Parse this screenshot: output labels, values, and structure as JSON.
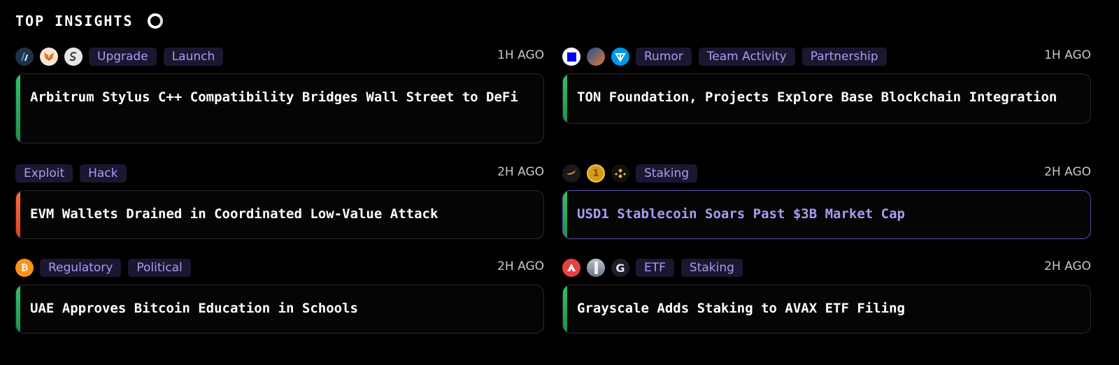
{
  "header": {
    "title": "TOP INSIGHTS"
  },
  "colors": {
    "green": "#2ec26a",
    "red": "#ff5a36",
    "tag_bg": "#1b1730",
    "tag_text": "#a99cf2"
  },
  "insights": [
    {
      "icons": [
        "arbitrum-icon",
        "metamask-icon",
        "sonic-icon"
      ],
      "tags": [
        "Upgrade",
        "Launch"
      ],
      "time": "1H AGO",
      "headline": "Arbitrum Stylus C++ Compatibility Bridges Wall Street to DeFi",
      "sentiment": "positive"
    },
    {
      "icons": [
        "blue-square-icon",
        "avatar-icon",
        "ton-icon"
      ],
      "tags": [
        "Rumor",
        "Team Activity",
        "Partnership"
      ],
      "time": "1H AGO",
      "headline": "TON Foundation, Projects Explore Base Blockchain Integration",
      "sentiment": "positive"
    },
    {
      "icons": [],
      "tags": [
        "Exploit",
        "Hack"
      ],
      "time": "2H AGO",
      "headline": "EVM Wallets Drained in Coordinated Low-Value Attack",
      "sentiment": "negative"
    },
    {
      "icons": [
        "bird-icon",
        "usd1-icon",
        "bnb-icon"
      ],
      "tags": [
        "Staking"
      ],
      "time": "2H AGO",
      "headline": "USD1 Stablecoin Soars Past $3B Market Cap",
      "sentiment": "positive",
      "highlighted": true
    },
    {
      "icons": [
        "bitcoin-icon"
      ],
      "tags": [
        "Regulatory",
        "Political"
      ],
      "time": "2H AGO",
      "headline": "UAE Approves Bitcoin Education in Schools",
      "sentiment": "positive"
    },
    {
      "icons": [
        "avalanche-icon",
        "tower-icon",
        "grayscale-icon"
      ],
      "tags": [
        "ETF",
        "Staking"
      ],
      "time": "2H AGO",
      "headline": "Grayscale Adds Staking to AVAX ETF Filing",
      "sentiment": "positive"
    }
  ]
}
